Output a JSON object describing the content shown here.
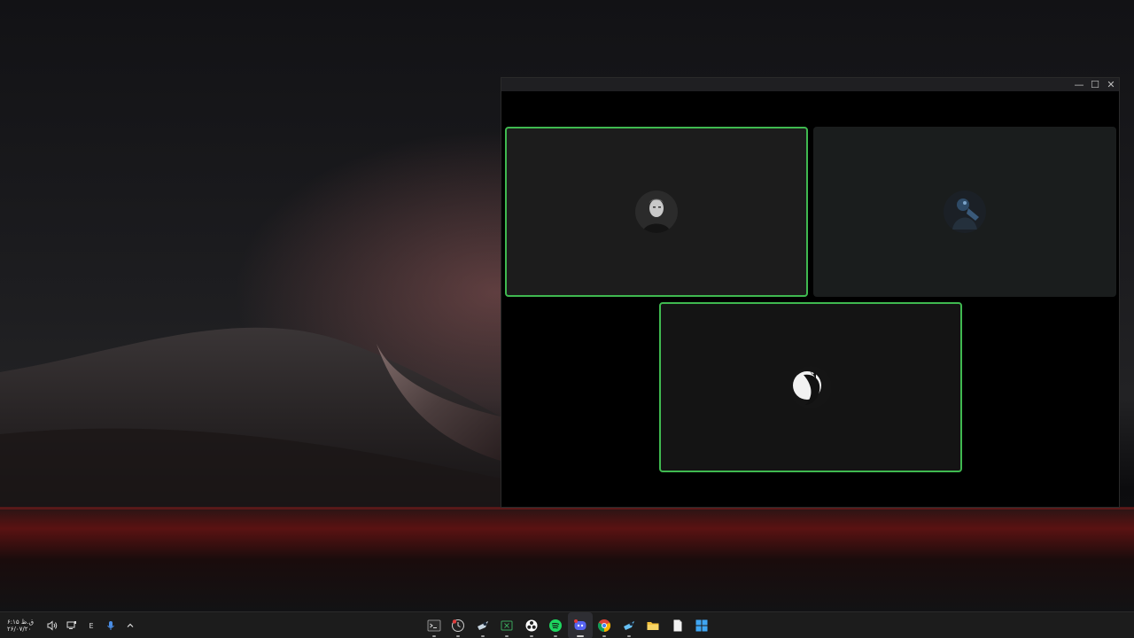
{
  "window": {
    "minimize_glyph": "—",
    "maximize_glyph": "☐",
    "close_glyph": "✕"
  },
  "call": {
    "participants": [
      {
        "avatar_icon": "user-avatar-man-portrait",
        "speaking": true,
        "tile_color": "#1c1c1c"
      },
      {
        "avatar_icon": "user-avatar-figure-dark",
        "speaking": false,
        "tile_color": "#1a1d1d"
      },
      {
        "avatar_icon": "user-avatar-silhouette",
        "speaking": true,
        "tile_color": "#141414"
      }
    ],
    "speaking_color": "#3fb950"
  },
  "taskbar": {
    "clock_time": "۶:۱۵ ق.ظ",
    "clock_date": "۲۶/۰۷/۲۰",
    "language": "E",
    "tray_icons": [
      "volume-icon",
      "network-icon",
      "language-indicator",
      "microphone-icon",
      "show-hidden-icons-chevron"
    ],
    "apps": [
      {
        "name": "terminal",
        "icon": "terminal-icon",
        "running": true
      },
      {
        "name": "clock-app",
        "icon": "clock-icon",
        "running": true
      },
      {
        "name": "steam",
        "icon": "steam-icon",
        "running": true
      },
      {
        "name": "excel-app",
        "icon": "spreadsheet-icon",
        "running": true
      },
      {
        "name": "obs",
        "icon": "obs-icon",
        "running": true
      },
      {
        "name": "spotify",
        "icon": "spotify-icon",
        "running": true
      },
      {
        "name": "discord",
        "icon": "discord-icon",
        "running": true
      },
      {
        "name": "chrome",
        "icon": "chrome-icon",
        "running": true
      },
      {
        "name": "steam-2",
        "icon": "steam-icon",
        "running": true
      },
      {
        "name": "file-explorer",
        "icon": "folder-icon",
        "running": false
      },
      {
        "name": "notepad",
        "icon": "document-icon",
        "running": false
      },
      {
        "name": "start",
        "icon": "windows-start-icon",
        "running": false
      }
    ]
  }
}
